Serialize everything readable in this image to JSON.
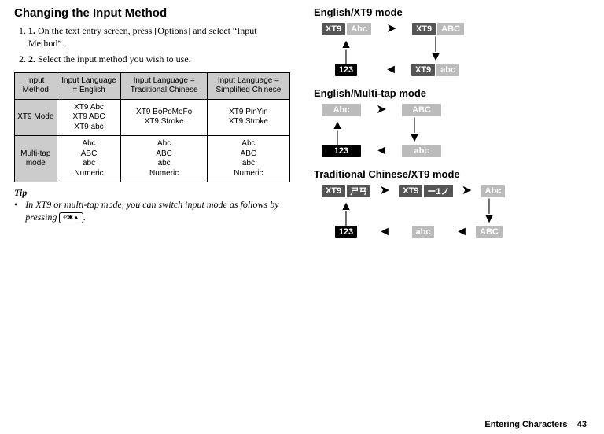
{
  "left": {
    "heading": "Changing the Input Method",
    "step1": "On the text entry screen, press [Options] and select “Input Method”.",
    "step2": "Select the input method you wish to use.",
    "table": {
      "h1": "Input Method",
      "h2": "Input Language = English",
      "h3": "Input Language = Traditional Chinese",
      "h4": "Input Language = Simplified Chinese",
      "r1c1": "XT9 Mode",
      "r1c2": "XT9 Abc\nXT9 ABC\nXT9 abc",
      "r1c3": "XT9 BoPoMoFo\nXT9 Stroke",
      "r1c4": "XT9 PinYin\nXT9 Stroke",
      "r2c1": "Multi-tap mode",
      "r2c2": "Abc\nABC\nabc\nNumeric",
      "r2c3": "Abc\nABC\nabc\nNumeric",
      "r2c4": "Abc\nABC\nabc\nNumeric"
    },
    "tip_label": "Tip",
    "tip_text_a": "In XT9 or multi-tap mode, you can switch input mode as follows by pressing ",
    "tip_text_b": ".",
    "key_glyph": "℗✱▲"
  },
  "right": {
    "h1": "English/XT9 mode",
    "h2": "English/Multi-tap mode",
    "h3": "Traditional Chinese/XT9 mode",
    "badge_xt9": "XT9",
    "badge_Abc": "Abc",
    "badge_ABC": "ABC",
    "badge_abc": "abc",
    "badge_123": "123",
    "badge_bopo": "ㄕㄢ",
    "badge_stroke": "ー1ノ"
  },
  "footer": {
    "section": "Entering Characters",
    "page": "43"
  }
}
